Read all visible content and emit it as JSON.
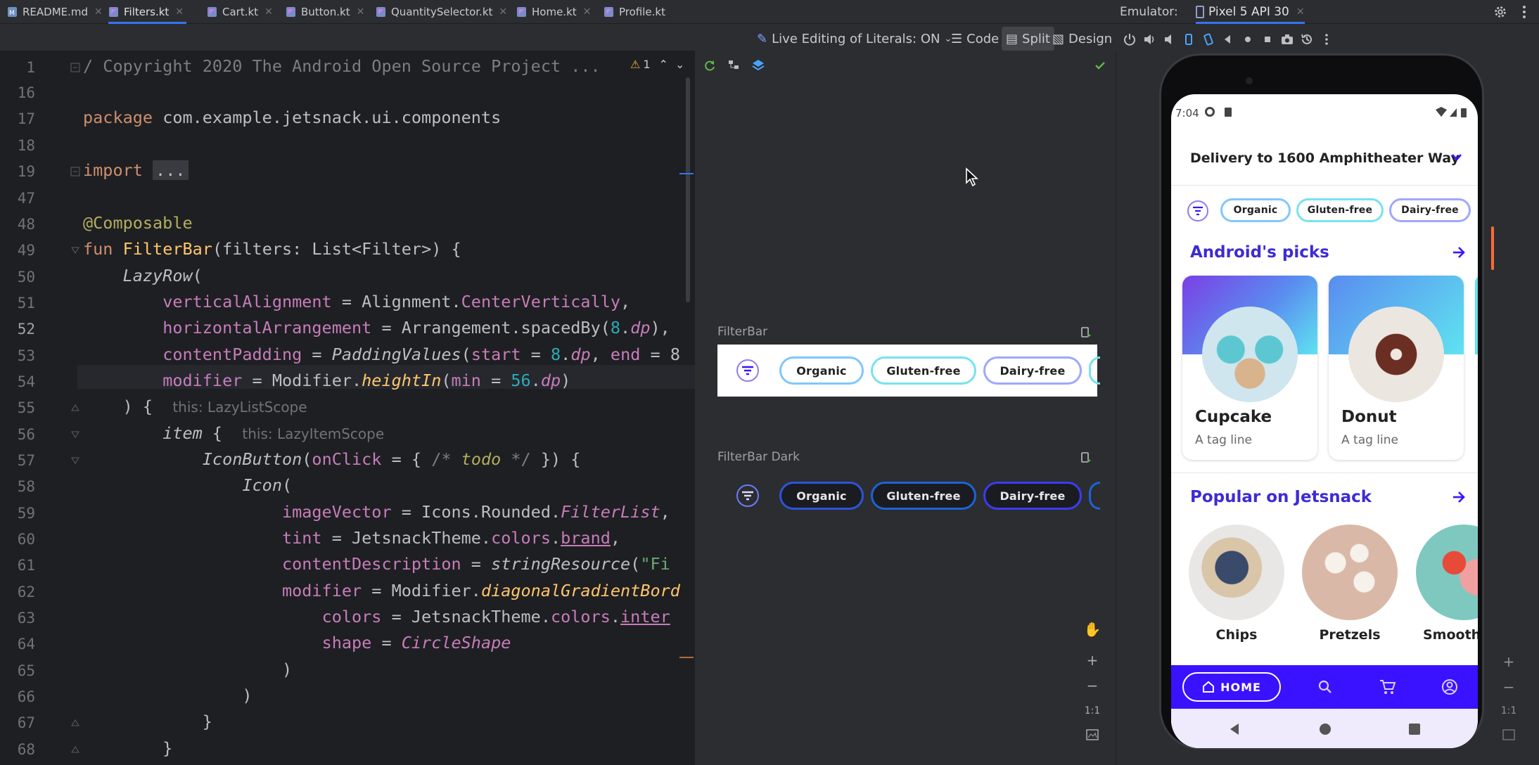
{
  "tabs": [
    {
      "label": "README.md",
      "active": false
    },
    {
      "label": "Filters.kt",
      "active": true
    },
    {
      "label": "Cart.kt",
      "active": false
    },
    {
      "label": "Button.kt",
      "active": false
    },
    {
      "label": "QuantitySelector.kt",
      "active": false
    },
    {
      "label": "Home.kt",
      "active": false
    },
    {
      "label": "Profile.kt",
      "active": false
    }
  ],
  "emulator": {
    "label": "Emulator:",
    "device": "Pixel 5 API 30"
  },
  "toolbar": {
    "live_editing": "Live Editing of Literals: ON",
    "code": "Code",
    "split": "Split",
    "design": "Design"
  },
  "editor": {
    "warning_count": "1",
    "line_numbers": [
      "1",
      "16",
      "17",
      "18",
      "19",
      "47",
      "48",
      "49",
      "50",
      "51",
      "52",
      "53",
      "54",
      "55",
      "56",
      "57",
      "58",
      "59",
      "60",
      "61",
      "62",
      "63",
      "64",
      "65",
      "66",
      "67",
      "68"
    ],
    "current_line": "52",
    "hints": {
      "this_lazylistscope": "this: LazyListScope",
      "this_lazyitemscope": "this: LazyItemScope"
    }
  },
  "preview": {
    "light_label": "FilterBar",
    "dark_label": "FilterBar Dark",
    "chips": [
      "Organic",
      "Gluten-free",
      "Dairy-free"
    ],
    "zoom_fit": "1:1"
  },
  "phone": {
    "time": "7:04",
    "delivery": "Delivery to 1600 Amphitheater Way",
    "chips": [
      "Organic",
      "Gluten-free",
      "Dairy-free"
    ],
    "section1": "Android's picks",
    "cards": [
      {
        "name": "Cupcake",
        "tag": "A tag line"
      },
      {
        "name": "Donut",
        "tag": "A tag line"
      }
    ],
    "section2": "Popular on Jetsnack",
    "popular": [
      "Chips",
      "Pretzels",
      "Smooth"
    ],
    "nav_home": "HOME",
    "brand_color": "#3a12ff",
    "title_color": "#3d2bd4"
  },
  "right_tools": {
    "zoom_fit": "1:1"
  }
}
